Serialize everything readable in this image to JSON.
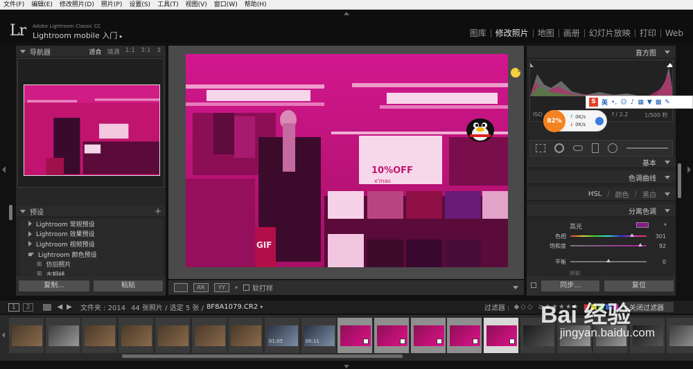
{
  "menu": [
    "文件(F)",
    "编辑(E)",
    "修改照片(D)",
    "照片(P)",
    "设置(S)",
    "工具(T)",
    "视图(V)",
    "窗口(W)",
    "帮助(H)"
  ],
  "identity": {
    "logo": "Lr",
    "product": "Adobe Lightroom Classic CC",
    "mobile": "Lightroom mobile 入门"
  },
  "modules": [
    {
      "label": "图库",
      "active": false
    },
    {
      "label": "修改照片",
      "active": true
    },
    {
      "label": "地图",
      "active": false
    },
    {
      "label": "画册",
      "active": false
    },
    {
      "label": "幻灯片放映",
      "active": false
    },
    {
      "label": "打印",
      "active": false
    },
    {
      "label": "Web",
      "active": false
    }
  ],
  "navigator": {
    "title": "导航器",
    "zoom_options": [
      "适合",
      "填满",
      "1:1",
      "3:1"
    ]
  },
  "presets": {
    "title": "预设",
    "items": [
      {
        "label": "Lightroom 常规预设",
        "expanded": false,
        "sub": false
      },
      {
        "label": "Lightroom 效果预设",
        "expanded": false,
        "sub": false
      },
      {
        "label": "Lightroom 视频预设",
        "expanded": false,
        "sub": false
      },
      {
        "label": "Lightroom 颜色预设",
        "expanded": true,
        "sub": false
      },
      {
        "label": "仿旧照片",
        "expanded": false,
        "sub": true
      },
      {
        "label": "古铜线",
        "expanded": false,
        "sub": true
      }
    ]
  },
  "left_buttons": {
    "copy": "复制...",
    "paste": "粘贴"
  },
  "toolbar": {
    "softproof": "软打样",
    "view_labels": [
      "RR",
      "YY"
    ]
  },
  "histogram": {
    "title": "直方图",
    "iso": "ISO",
    "aperture": "f / 2.2",
    "shutter": "1/500 秒",
    "mm": "mm"
  },
  "right_panels": {
    "basic": "基本",
    "tone_curve": "色调曲线",
    "hsl": "HSL",
    "color": "颜色",
    "bw": "黑白",
    "split_toning": "分离色调"
  },
  "split_toning": {
    "highlights": "高光",
    "hue_label": "色相",
    "hue_value": "301",
    "sat_label": "饱和度",
    "sat_value": "92",
    "balance_label": "平衡",
    "balance_value": "0",
    "shadows_partial": "阴影",
    "highlight_color": "#8a1a8a"
  },
  "right_buttons": {
    "sync": "同步...",
    "reset": "复位"
  },
  "filmstrip_bar": {
    "page1": "1",
    "page2": "2",
    "folder_label": "文件夹 : 2014",
    "counts": "44 张照片 / 选定 5 张 /",
    "filename": "8F8A1079.CR2",
    "filter_label": "过滤器 :",
    "filter_off": "关闭过滤器"
  },
  "filmstrip": {
    "thumbs": [
      {
        "tone": "warm",
        "caption": "",
        "state": "normal"
      },
      {
        "tone": "neutral",
        "caption": "",
        "state": "normal"
      },
      {
        "tone": "warm",
        "caption": "",
        "state": "normal"
      },
      {
        "tone": "warm",
        "caption": "",
        "state": "normal"
      },
      {
        "tone": "warm",
        "caption": "",
        "state": "normal"
      },
      {
        "tone": "warm",
        "caption": "",
        "state": "normal"
      },
      {
        "tone": "warm",
        "caption": "",
        "state": "normal"
      },
      {
        "tone": "cool",
        "caption": "01:05",
        "state": "normal"
      },
      {
        "tone": "cool",
        "caption": "00:11",
        "state": "normal"
      },
      {
        "tone": "magenta",
        "caption": "",
        "state": "sel"
      },
      {
        "tone": "magenta",
        "caption": "",
        "state": "sel"
      },
      {
        "tone": "magenta",
        "caption": "",
        "state": "sel"
      },
      {
        "tone": "magenta",
        "caption": "",
        "state": "sel"
      },
      {
        "tone": "magenta",
        "caption": "",
        "state": "active"
      },
      {
        "tone": "dark",
        "caption": "",
        "state": "normal"
      },
      {
        "tone": "neutral",
        "caption": "",
        "state": "normal"
      },
      {
        "tone": "neutral",
        "caption": "",
        "state": "normal"
      },
      {
        "tone": "dark",
        "caption": "",
        "state": "normal"
      },
      {
        "tone": "neutral",
        "caption": "",
        "state": "normal"
      }
    ]
  },
  "photo_text": {
    "sale": "10%OFF",
    "brand": "x'mas",
    "bag": "MU GIF"
  },
  "overlays": {
    "lightbulb_count": "5",
    "ime_label": "英",
    "speed_percent": "82%",
    "speed_up": "0K/s",
    "speed_down": "0K/s",
    "watermark_main": "Bai 经验",
    "watermark_url": "jingyan.baidu.com"
  },
  "colors": {
    "magenta": "#e0128a",
    "panel": "#2b2b2b",
    "accent_orange": "#f58220"
  }
}
